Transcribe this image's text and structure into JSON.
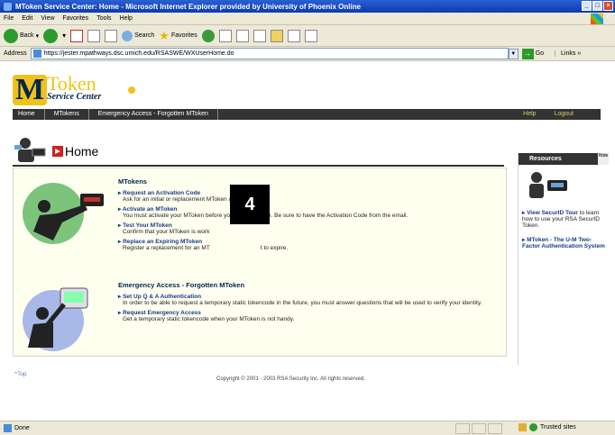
{
  "browser": {
    "title": "MToken Service Center: Home - Microsoft Internet Explorer provided by University of Phoenix Online",
    "menu": [
      "File",
      "Edit",
      "View",
      "Favorites",
      "Tools",
      "Help"
    ],
    "toolbar": {
      "back": "Back",
      "search": "Search",
      "favorites": "Favorites"
    },
    "address_label": "Address",
    "url": "https://jester.mpathways.dsc.umich.edu/RSASWE/WXUserHome.do",
    "go": "Go",
    "links": "Links"
  },
  "site": {
    "logo_letter": "M",
    "logo_word": "Token",
    "logo_sub": "Service Center",
    "nav": [
      "Home",
      "MTokens",
      "Emergency Access - Forgotten MToken"
    ],
    "nav_right": [
      "Help",
      "Logout"
    ]
  },
  "home": {
    "title": "Home"
  },
  "mtokens": {
    "title": "MTokens",
    "items": [
      {
        "link": "Request an Activation Code",
        "desc": "Ask for an initial or replacement MToken activation code."
      },
      {
        "link": "Activate an MToken",
        "desc": "You must activate your MToken before you can use it use. Be sure to have the Activation Code from the email."
      },
      {
        "link": "Test Your MToken",
        "desc": "Confirm that your MToken is work"
      },
      {
        "link": "Replace an Expiring MToken",
        "desc": "Register a replacement for an MT"
      }
    ],
    "desc_tail": "t to expire."
  },
  "emergency": {
    "title": "Emergency Access - Forgotten MToken",
    "items": [
      {
        "link": "Set Up Q & A Authentication",
        "desc": "In order to be able to request a temporary static tokencode in the future, you must answer questions that will be used to verify your identity."
      },
      {
        "link": "Request Emergency Access",
        "desc": "Get a temporary static tokencode when your MToken is not handy."
      }
    ]
  },
  "badge": "4",
  "resources": {
    "title": "Resources",
    "hide": "Hide",
    "items": [
      {
        "link": "View SecurID Tour",
        "desc": " to learn how to use your RSA SecurID Token."
      },
      {
        "link": "MToken - The U-M Two-Factor Authentication System",
        "desc": ""
      }
    ]
  },
  "footer": {
    "top": "Top",
    "copyright": "Copyright © 2001 - 2003 RSA Security Inc. All rights reserved."
  },
  "status": {
    "done": "Done",
    "zone": "Trusted sites"
  },
  "colors": {
    "maize": "#f1c21b",
    "blue": "#00274c",
    "nav": "#333333",
    "accent_red": "#d02020"
  }
}
